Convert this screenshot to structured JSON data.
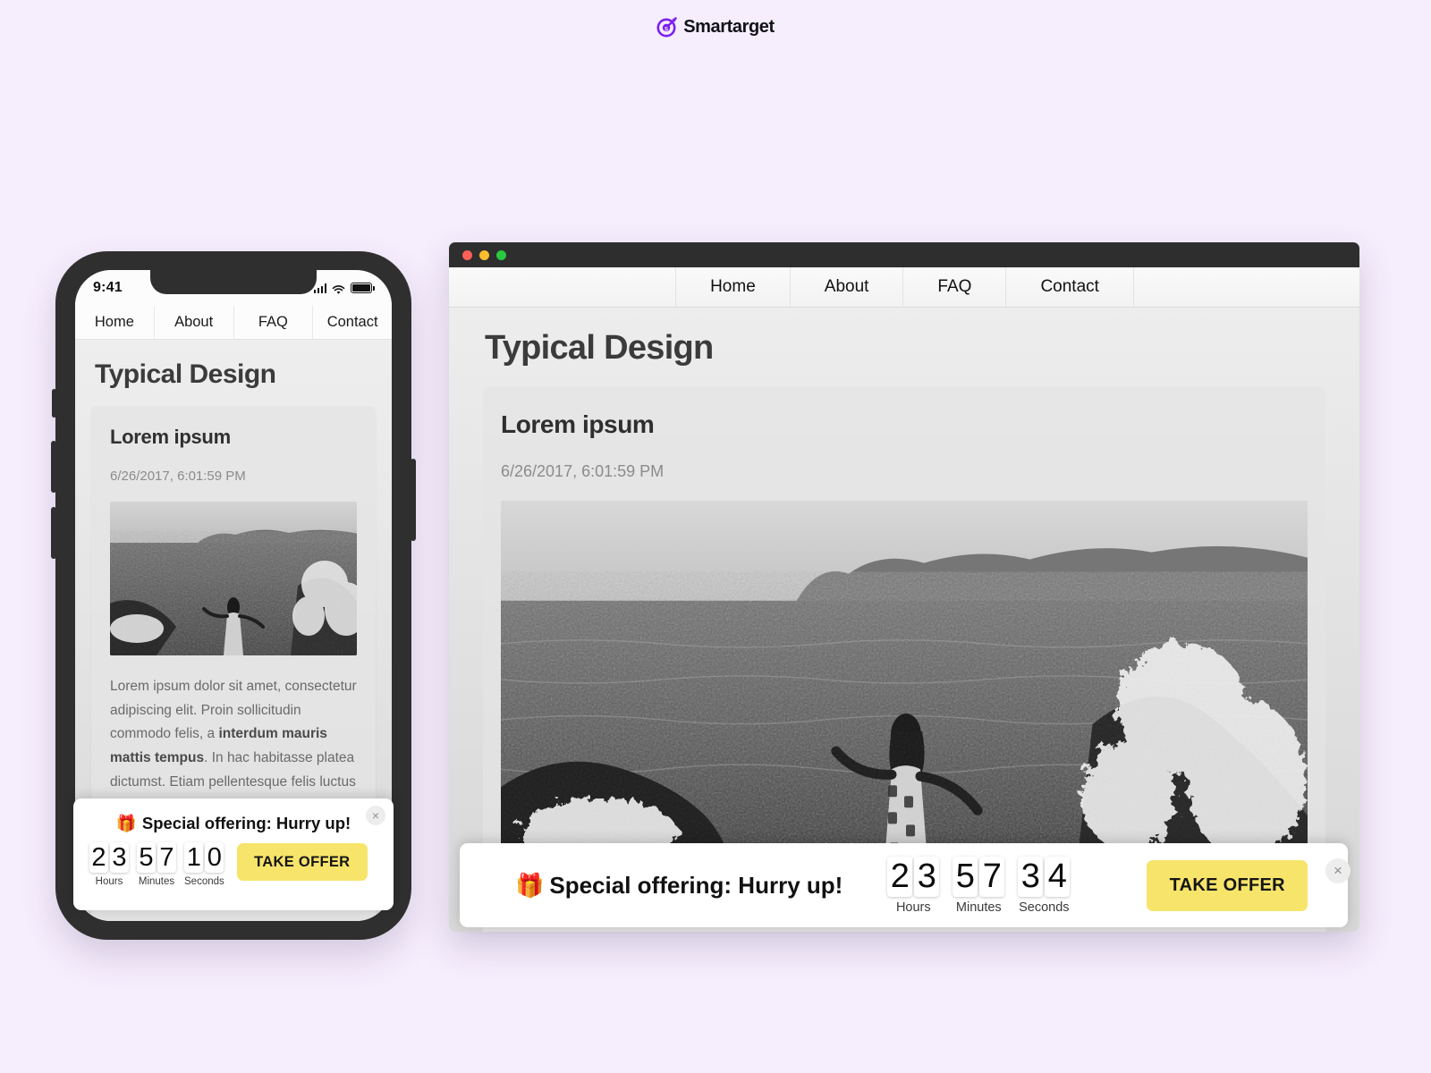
{
  "brand": {
    "name": "Smartarget",
    "icon": "target-dart-icon",
    "color": "#7b1ff0"
  },
  "colors": {
    "page_background": "#f6eefd",
    "offer_button": "#f7e46a",
    "titlebar": "#2e2e2e",
    "traffic_red": "#ff5f57",
    "traffic_yellow": "#febc2e",
    "traffic_green": "#28c840"
  },
  "mobile": {
    "status": {
      "time": "9:41",
      "signal_icon": "cellular-signal-icon",
      "wifi_icon": "wifi-icon",
      "battery_icon": "battery-full-icon"
    },
    "nav": [
      {
        "label": "Home"
      },
      {
        "label": "About"
      },
      {
        "label": "FAQ"
      },
      {
        "label": "Contact"
      }
    ],
    "page_title": "Typical Design",
    "card": {
      "title": "Lorem ipsum",
      "date": "6/26/2017, 6:01:59 PM",
      "image_alt": "woman-on-rocky-seashore-photo",
      "body_part1": "Lorem ipsum dolor sit amet, consectetur adipiscing elit. Proin sollicitudin commodo felis, a ",
      "body_bold": "interdum mauris mattis tempus",
      "body_part2": ". In hac habitasse platea dictumst. Etiam pellentesque felis luctus turpis."
    },
    "banner": {
      "title": "Special offering: Hurry up!",
      "gift_icon": "🎁",
      "close_icon": "×",
      "button_label": "TAKE OFFER",
      "countdown": [
        {
          "value": "23",
          "label": "Hours"
        },
        {
          "value": "57",
          "label": "Minutes"
        },
        {
          "value": "10",
          "label": "Seconds"
        }
      ]
    }
  },
  "desktop": {
    "window_controls": [
      {
        "name": "close",
        "color": "#ff5f57"
      },
      {
        "name": "minimize",
        "color": "#febc2e"
      },
      {
        "name": "maximize",
        "color": "#28c840"
      }
    ],
    "nav": [
      {
        "label": "Home"
      },
      {
        "label": "About"
      },
      {
        "label": "FAQ"
      },
      {
        "label": "Contact"
      }
    ],
    "page_title": "Typical Design",
    "card": {
      "title": "Lorem ipsum",
      "date": "6/26/2017, 6:01:59 PM",
      "image_alt": "woman-on-rocky-seashore-photo"
    },
    "banner": {
      "title": "Special offering: Hurry up!",
      "gift_icon": "🎁",
      "close_icon": "×",
      "button_label": "TAKE OFFER",
      "countdown": [
        {
          "value": "23",
          "label": "Hours"
        },
        {
          "value": "57",
          "label": "Minutes"
        },
        {
          "value": "34",
          "label": "Seconds"
        }
      ]
    }
  }
}
